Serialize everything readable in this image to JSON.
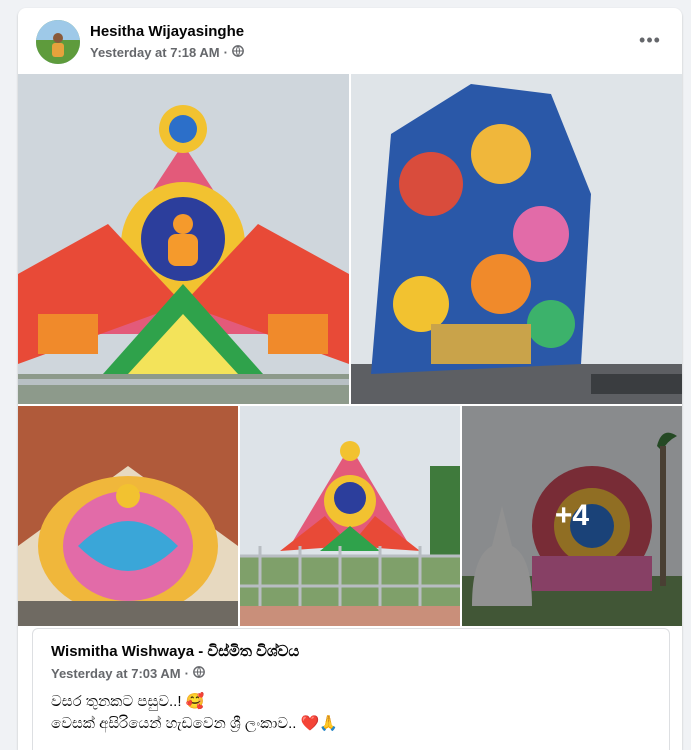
{
  "post": {
    "author": "Hesitha Wijayasinghe",
    "time": "Yesterday at 7:18 AM",
    "separator": "·",
    "more_label": "•••",
    "privacy_icon": "globe-icon"
  },
  "photos": {
    "extra_count": "+4"
  },
  "shared_post": {
    "author": "Wismitha Wishwaya - විස්මිත විශ්වය",
    "time": "Yesterday at 7:03 AM",
    "separator": "·",
    "line1": "වසර තුනකට පසුව..! 🥰",
    "line2": "වෙසක් අසිරියෙන් හැඩවෙන ශ්‍රී ලංකාව.. ❤️🙏"
  },
  "colors": {
    "card_bg": "#ffffff",
    "page_bg": "#f0f2f5",
    "secondary_text": "#65676b"
  }
}
